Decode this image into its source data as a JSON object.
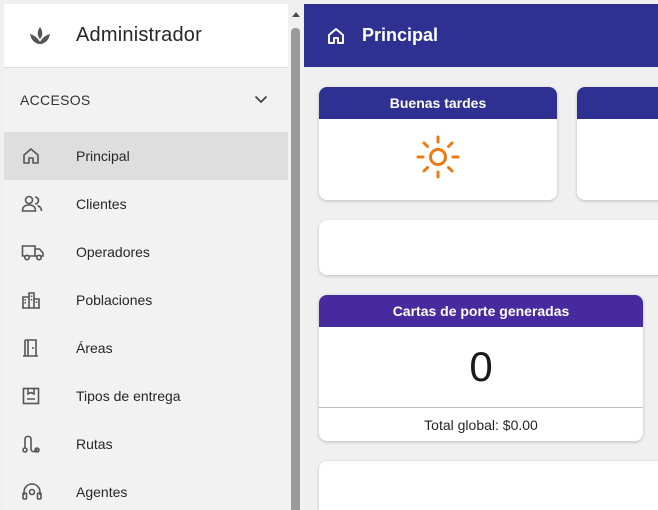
{
  "sidebar": {
    "title": "Administrador",
    "section": "ACCESOS",
    "items": [
      {
        "label": "Principal",
        "icon": "home-icon",
        "active": true
      },
      {
        "label": "Clientes",
        "icon": "users-icon"
      },
      {
        "label": "Operadores",
        "icon": "truck-icon"
      },
      {
        "label": "Poblaciones",
        "icon": "city-icon"
      },
      {
        "label": "Áreas",
        "icon": "door-icon"
      },
      {
        "label": "Tipos de entrega",
        "icon": "box-icon"
      },
      {
        "label": "Rutas",
        "icon": "route-icon"
      },
      {
        "label": "Agentes",
        "icon": "headset-icon"
      }
    ]
  },
  "header": {
    "title": "Principal"
  },
  "greeting": {
    "title": "Buenas tardes",
    "icon": "sun-icon"
  },
  "cartas": {
    "title": "Cartas de porte generadas",
    "value": "0",
    "footer": "Total global: $0.00"
  },
  "colors": {
    "primary": "#2e3192",
    "purple": "#472a9e",
    "sun": "#ea7a12"
  }
}
